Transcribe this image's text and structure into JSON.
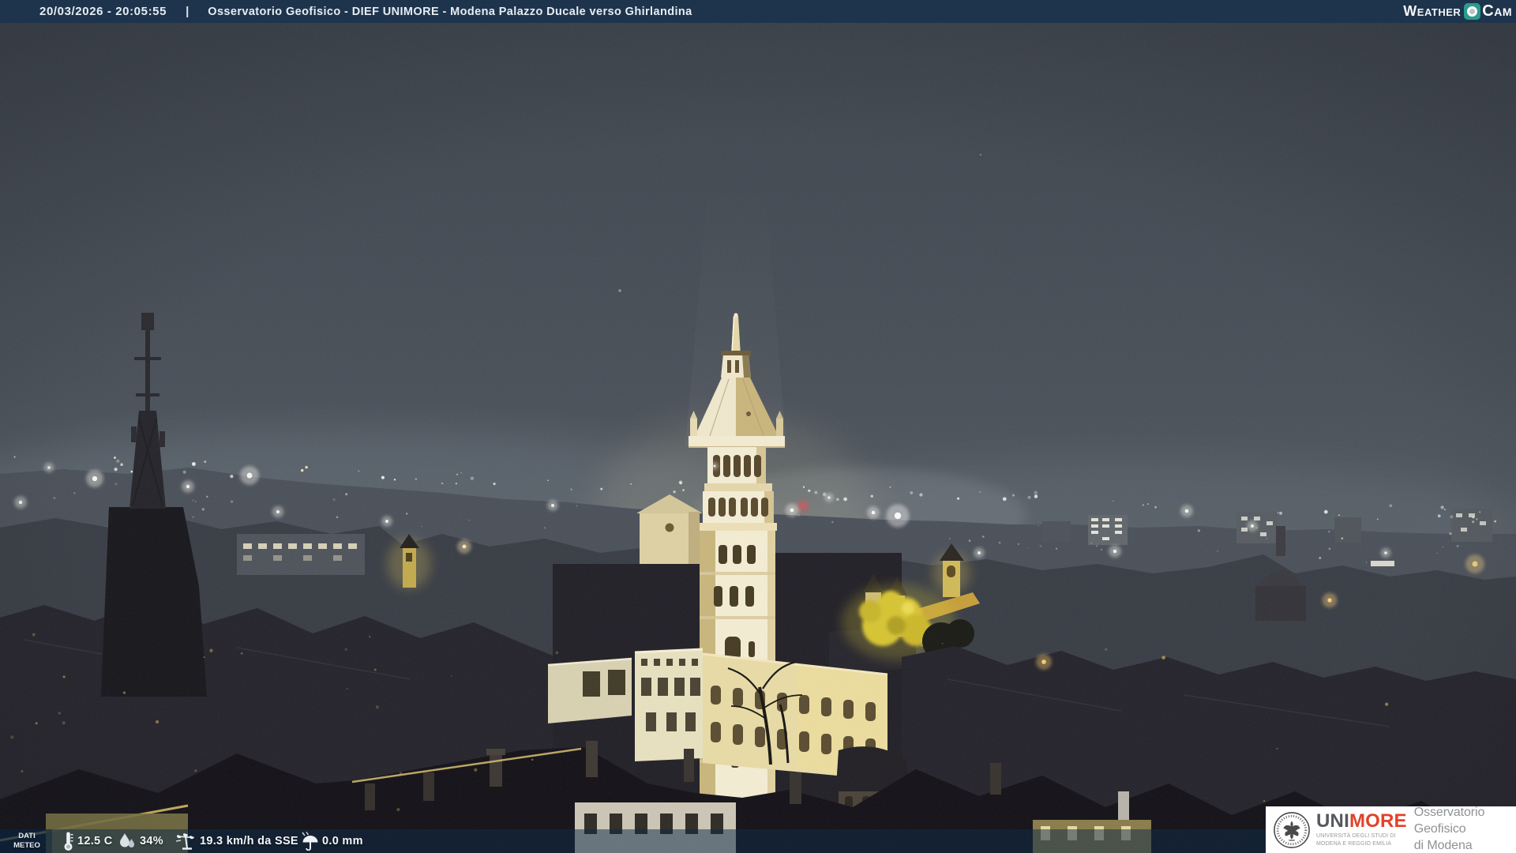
{
  "header": {
    "timestamp": "20/03/2026 - 20:05:55",
    "separator": "|",
    "title": "Osservatorio Geofisico - DIEF UNIMORE - Modena Palazzo Ducale verso Ghirlandina",
    "weathercam_weather": "Weather",
    "weathercam_cam": "Cam"
  },
  "weather_bar": {
    "label_line1": "DATI",
    "label_line2": "METEO",
    "temperature": "12.5 C",
    "humidity": "34%",
    "wind": "19.3 km/h da SSE",
    "precipitation": "0.0 mm"
  },
  "branding": {
    "acronym_gray": "UNI",
    "acronym_red": "MORE",
    "university_line1": "UNIVERSITÀ DEGLI STUDI DI",
    "university_line2": "MODENA E REGGIO EMILIA",
    "observatory_line1": "Osservatorio Geofisico",
    "observatory_line2": "di Modena"
  },
  "scene": {
    "subject": "Night webcam view over Modena rooftops with the illuminated Ghirlandina tower"
  },
  "colors": {
    "header_bg": "#1e344c",
    "overlay_bar": "rgba(16,44,72,0.52)",
    "weathercam_teal": "#2b9c8e",
    "unimore_red": "#e2422a"
  }
}
